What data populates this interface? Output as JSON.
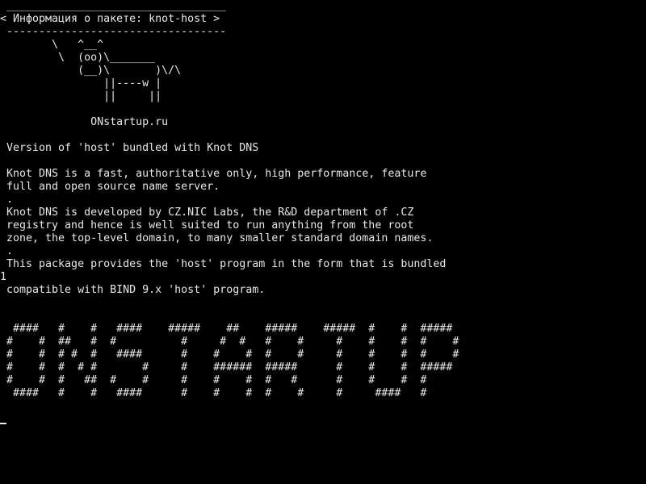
{
  "screen": {
    "background_color": "#000000",
    "text_color": "#e8e8e8",
    "lines": [
      " __________________________________",
      "< Информация о пакете: knot-host >",
      " ----------------------------------",
      "        \\   ^__^",
      "         \\  (oo)\\_______",
      "            (__)\\       )\\/\\",
      "                ||----w |",
      "                ||     ||",
      "",
      "              ONstartup.ru",
      "",
      " Version of 'host' bundled with Knot DNS",
      "",
      " Knot DNS is a fast, authoritative only, high performance, feature",
      " full and open source name server.",
      " .",
      " Knot DNS is developed by CZ.NIC Labs, the R&D department of .CZ",
      " registry and hence is well suited to run anything from the root",
      " zone, the top-level domain, to many smaller standard domain names.",
      " .",
      " This package provides the 'host' program in the form that is bundled",
      "1",
      " compatible with BIND 9.x 'host' program.",
      "",
      "",
      "  ####   #    #   ####    #####    ##    #####    #####  #    #  #####",
      " #    #  ##   #  #          #     #  #   #    #     #    #    #  #    #",
      " #    #  # #  #   ####      #    #    #  #    #     #    #    #  #    #",
      " #    #  #  # #       #     #    ######  #####      #    #    #  #####",
      " #    #  #   ##  #    #     #    #    #  #   #      #    #    #  #",
      "  ####   #    #   ####      #    #    #  #    #     #     ####   #"
    ]
  }
}
